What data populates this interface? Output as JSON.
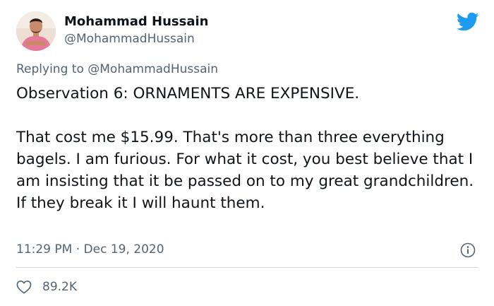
{
  "tweet": {
    "author_name": "Mohammad Hussain",
    "author_handle": "@MohammadHussain",
    "reply_prefix": "Replying to",
    "reply_to": "@MohammadHussain",
    "paragraphs": [
      "Observation 6: ORNAMENTS ARE EXPENSIVE.",
      "That cost me $15.99. That's more than three everything bagels. I am furious. For what it cost, you best believe that I am insisting that it be passed on to my great grandchildren. If they break it I will haunt them."
    ],
    "timestamp": "11:29 PM · Dec 19, 2020",
    "likes": "89.2K"
  },
  "colors": {
    "brand": "#1d9bf0",
    "text_primary": "#0f1419",
    "text_secondary": "#536471",
    "divider": "#cfd9de"
  },
  "icons": {
    "logo": "twitter-bird-icon",
    "info": "info-icon",
    "like": "heart-icon"
  }
}
